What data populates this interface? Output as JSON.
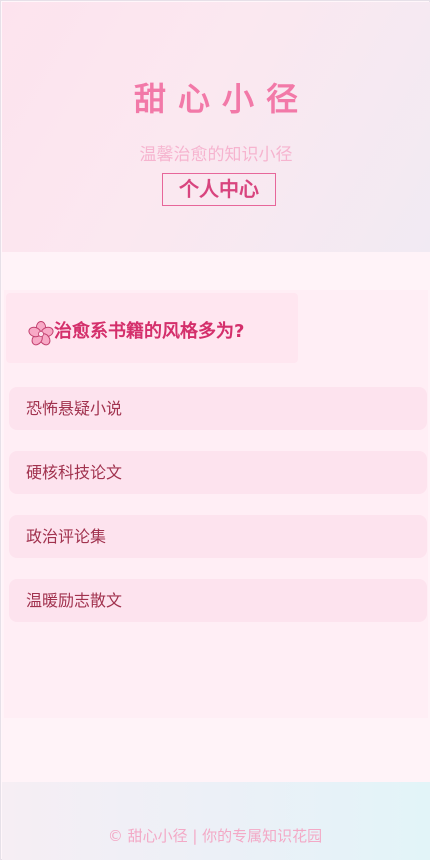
{
  "header": {
    "site_title": "甜心小径",
    "subtitle": "温馨治愈的知识小径",
    "profile_link": "个人中心"
  },
  "quiz": {
    "question": "治愈系书籍的风格多为?",
    "icon": "cherry-blossom-icon",
    "options": [
      {
        "label": "恐怖悬疑小说"
      },
      {
        "label": "硬核科技论文"
      },
      {
        "label": "政治评论集"
      },
      {
        "label": "温暖励志散文"
      }
    ]
  },
  "footer": {
    "text": "© 甜心小径 | 你的专属知识花园"
  },
  "colors": {
    "accent": "#f279a8",
    "question": "#d42f6b",
    "option_text": "#a1324e",
    "option_bg": "#fde3ee"
  }
}
